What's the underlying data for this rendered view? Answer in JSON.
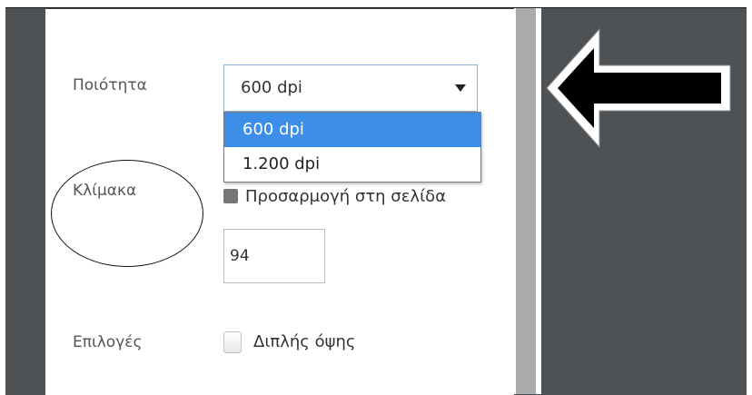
{
  "print_settings": {
    "quality": {
      "label": "Ποιότητα",
      "selected_value": "600 dpi",
      "options": [
        "600 dpi",
        "1.200 dpi"
      ]
    },
    "scale": {
      "label": "Κλίμακα",
      "fit_to_page_label": "Προσαρμογή στη σελίδα",
      "value": "94"
    },
    "options": {
      "label": "Επιλογές",
      "two_sided_label": "Διπλής όψης"
    }
  },
  "annotations": {
    "arrow_direction": "left",
    "circle_target": "Κλίμακα"
  },
  "colors": {
    "dropdown_highlight": "#3d8ee8",
    "frame_background": "#4f5254",
    "scrollbar": "#a9abad"
  }
}
